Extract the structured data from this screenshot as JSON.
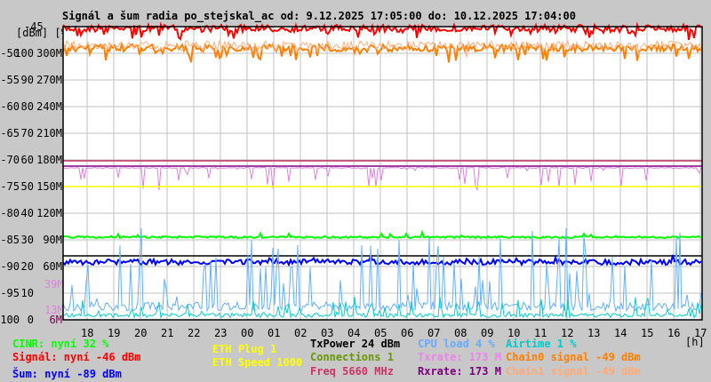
{
  "title": "Signál a šum radia po_stejskal_ac od: 9.12.2025 17:05:00 do: 10.12.2025 17:04:00",
  "units_label": "[dBm] [%]",
  "top_label": "-45",
  "hour_unit": "[h]",
  "chart_data": {
    "type": "line",
    "title": "Signál a šum radia po_stejskal_ac od: 9.12.2025 17:05:00 do: 10.12.2025 17:04:00",
    "x_ticks": [
      "18",
      "19",
      "20",
      "21",
      "22",
      "23",
      "00",
      "01",
      "02",
      "03",
      "04",
      "05",
      "06",
      "07",
      "08",
      "09",
      "10",
      "11",
      "12",
      "13",
      "14",
      "15",
      "16",
      "17"
    ],
    "y_ticks": [
      {
        "dbm": "-50",
        "pct": "100",
        "rate": "300M"
      },
      {
        "dbm": "-55",
        "pct": "90",
        "rate": "270M"
      },
      {
        "dbm": "-60",
        "pct": "80",
        "rate": "240M"
      },
      {
        "dbm": "-65",
        "pct": "70",
        "rate": "210M"
      },
      {
        "dbm": "-70",
        "pct": "60",
        "rate": "180M"
      },
      {
        "dbm": "-75",
        "pct": "50",
        "rate": "150M"
      },
      {
        "dbm": "-80",
        "pct": "40",
        "rate": "120M"
      },
      {
        "dbm": "-85",
        "pct": "30",
        "rate": "90M"
      },
      {
        "dbm": "-90",
        "pct": "20",
        "rate": "60M"
      },
      {
        "dbm": "-95",
        "pct": "10",
        "rate": ""
      },
      {
        "dbm": "-100",
        "pct": "0",
        "rate": "6M"
      }
    ],
    "extra_rate_ticks": [
      "39M",
      "13M"
    ],
    "ylim_dbm": [
      -100,
      -45
    ],
    "series": [
      {
        "name": "Signál",
        "unit": "dBm",
        "level": -46,
        "color": "#ff0000"
      },
      {
        "name": "Chain0 signal",
        "unit": "dBm",
        "level": -49,
        "color": "#ff8000"
      },
      {
        "name": "Chain1 signal",
        "unit": "dBm",
        "level": -49,
        "color": "#ffb080"
      },
      {
        "name": "Freq",
        "level_rate_M": 179,
        "color": "#c03060"
      },
      {
        "name": "Rxrate",
        "level_rate_M": 173,
        "color": "#800080"
      },
      {
        "name": "Txrate",
        "level_rate_M": 173,
        "color": "#e080e0"
      },
      {
        "name": "ETH Speed",
        "level_rate_M": 150,
        "color": "#ffff00"
      },
      {
        "name": "CINR",
        "unit": "%",
        "level": 32,
        "color": "#00ff00"
      },
      {
        "name": "TxPower",
        "level_dbm": -88,
        "color": "#000000"
      },
      {
        "name": "Šum",
        "unit": "dBm",
        "level": -89,
        "color": "#0000ff"
      },
      {
        "name": "CPU load",
        "unit": "%",
        "level": 4,
        "color": "#60b0ff"
      },
      {
        "name": "Airtime",
        "unit": "%",
        "level": 1,
        "color": "#00d0d0"
      }
    ]
  },
  "legend": {
    "cinr": "CINR: nyní 32 %",
    "signal": "Signál: nyní -46 dBm",
    "noise": "Šum: nyní -89 dBm",
    "eth_plug": "ETH Plug 1",
    "eth_speed": "ETH Speed 1000",
    "txpower": "TxPower 24 dBm",
    "connections": "Connections 1",
    "freq": "Freq 5660 MHz",
    "cpu": "CPU load 4 %",
    "txrate": "Txrate: 173 M",
    "rxrate": "Rxrate: 173 M",
    "airtime": "Airtime 1 %",
    "chain0": "Chain0 signal -49 dBm",
    "chain1": "Chain1 signal -49 dBm"
  },
  "colors": {
    "cinr": "#00ff00",
    "signal": "#ff0000",
    "noise": "#0000ff",
    "eth": "#ffff00",
    "txpower": "#000000",
    "connections": "#669900",
    "freq": "#cc3366",
    "cpu": "#66aaff",
    "txrate": "#ee82ee",
    "rxrate": "#800080",
    "airtime": "#00cccc",
    "chain0": "#ff8000",
    "chain1": "#ffaa77"
  }
}
